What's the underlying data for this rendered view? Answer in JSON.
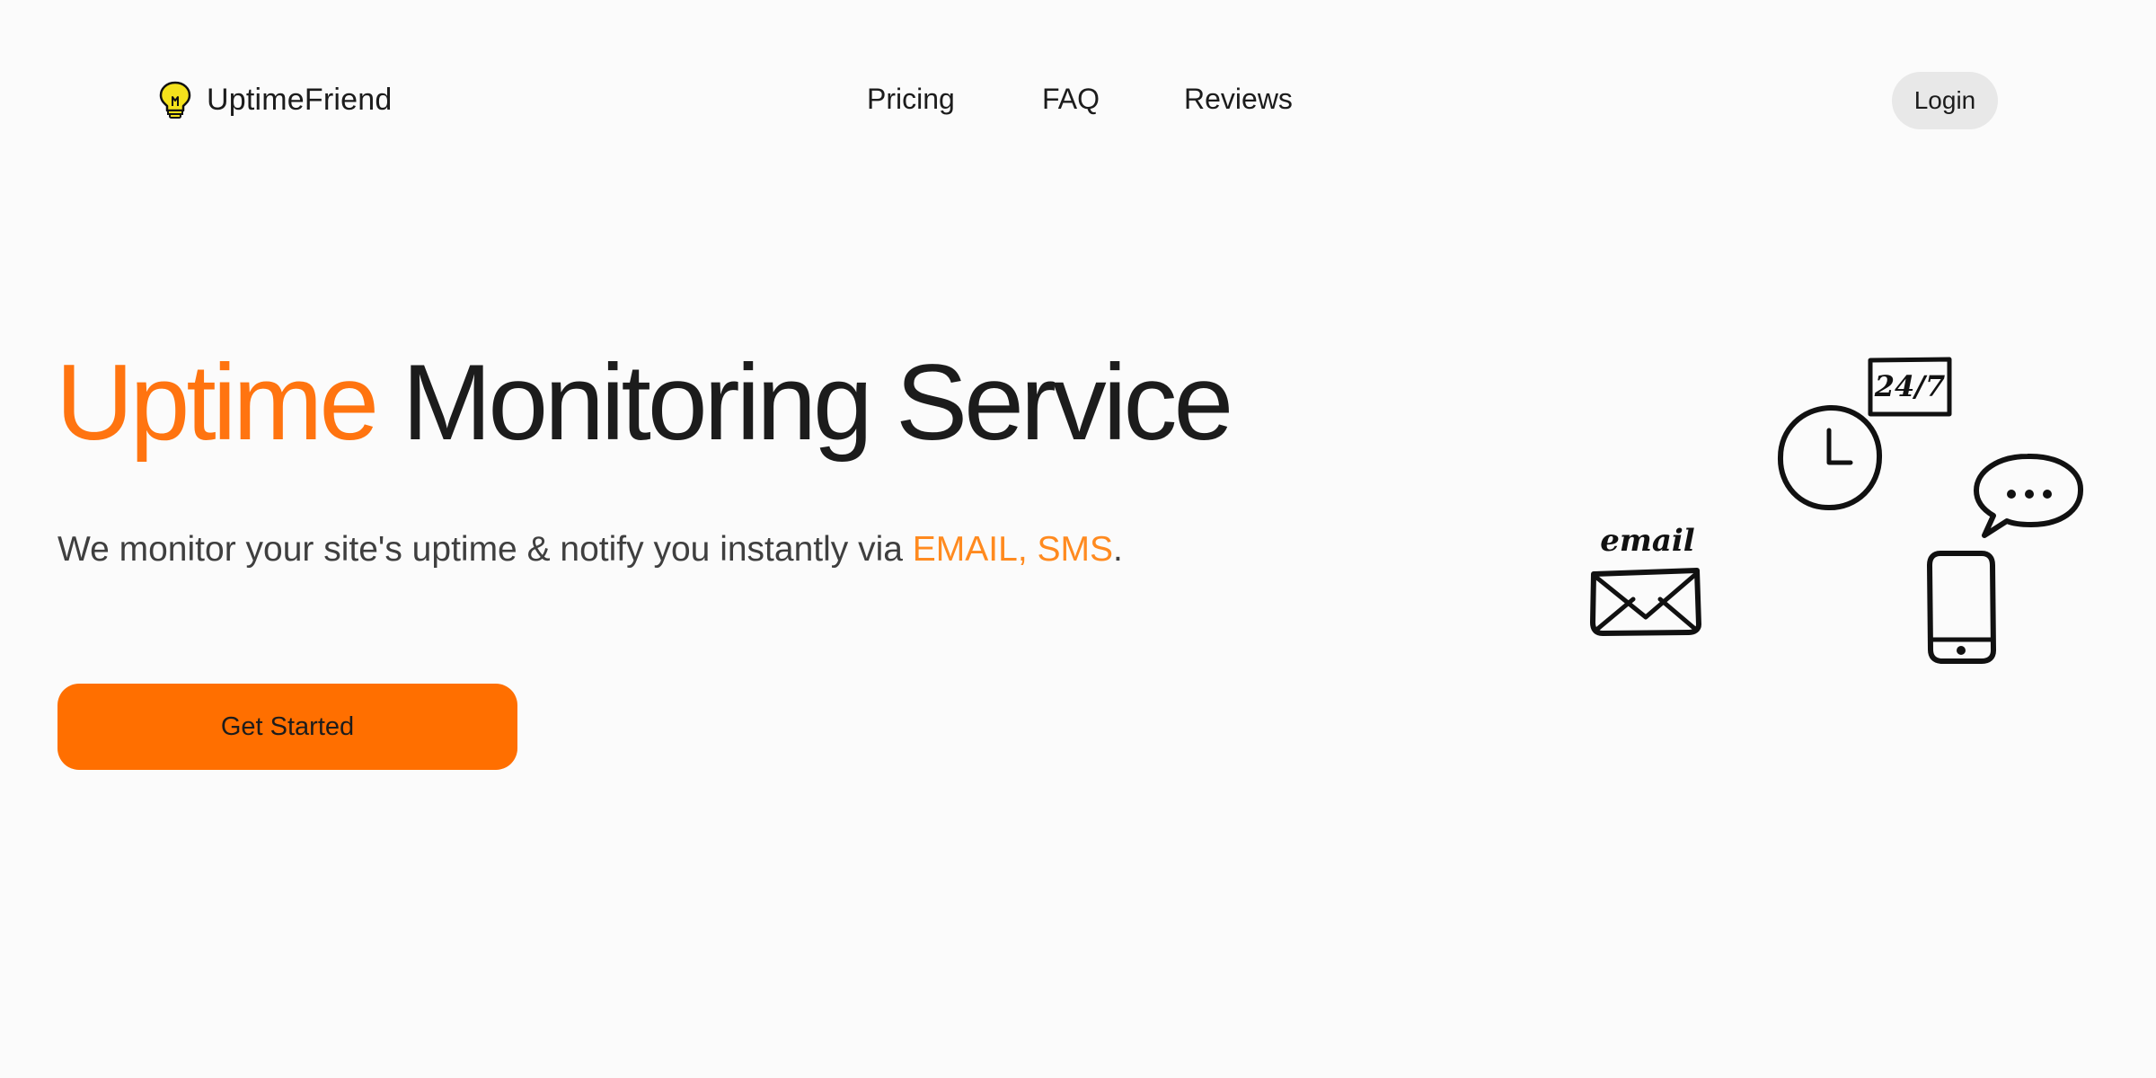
{
  "brand": {
    "name": "UptimeFriend",
    "icon": "lightbulb-icon"
  },
  "nav": {
    "items": [
      {
        "label": "Pricing"
      },
      {
        "label": "FAQ"
      },
      {
        "label": "Reviews"
      }
    ],
    "login_label": "Login"
  },
  "hero": {
    "title_accent": "Uptime",
    "title_rest": "Monitoring Service",
    "subtitle_prefix": "We monitor your site's uptime & notify you instantly via ",
    "subtitle_highlight": "EMAIL, SMS",
    "subtitle_suffix": ".",
    "cta_label": "Get Started"
  },
  "illustration": {
    "email_label": "email",
    "clock_badge": "24/7",
    "icons": [
      "clock-icon",
      "calendar-24-7-icon",
      "speech-bubble-icon",
      "email-envelope-icon",
      "smartphone-icon"
    ]
  },
  "colors": {
    "accent": "#ff7410",
    "highlight": "#ff8a1f",
    "cta_background": "#ff6f00",
    "login_background": "#e8e8e8",
    "page_background": "#fbfbfb",
    "logo_yellow": "#f4e21c"
  }
}
